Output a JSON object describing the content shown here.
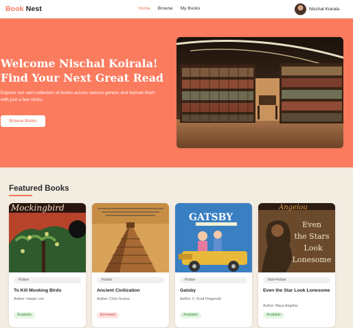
{
  "brand": {
    "part1": "Book",
    "part2": "Nest"
  },
  "nav": {
    "links": [
      {
        "label": "Home"
      },
      {
        "label": "Browse"
      },
      {
        "label": "My Books"
      }
    ],
    "user_name": "Nischal Koirala"
  },
  "hero": {
    "title_line1": "Welcome Nischal Koirala!",
    "title_line2": "Find Your Next Great Read",
    "subtitle": "Explore our vast collection of books across various genres and borrow them with just a few clicks.",
    "button_label": "Browse Books"
  },
  "featured": {
    "title": "Featured Books",
    "books": [
      {
        "genre": "Fiction",
        "title": "To Kill Mooking Birds",
        "author": "Author: Harper Lee",
        "status": "Available",
        "cover_text": "Mockingbird"
      },
      {
        "genre": "Fiction",
        "title": "Ancient Civilization",
        "author": "Author: Chris Scarne",
        "status": "Borrowed",
        "cover_text": ""
      },
      {
        "genre": "Fiction",
        "title": "Gatsby",
        "author": "Author: F. Scott Fitzgerald",
        "status": "Available",
        "cover_text": "GATSBY"
      },
      {
        "genre": "Non-Fiction",
        "title": "Even the Star Look Lonesome",
        "author": "Author: Maya Angelou",
        "status": "Available",
        "cover_text": "Even the Stars Look Lonesome"
      }
    ]
  },
  "colors": {
    "accent": "#fb7b5f",
    "background": "#f3ece1"
  }
}
